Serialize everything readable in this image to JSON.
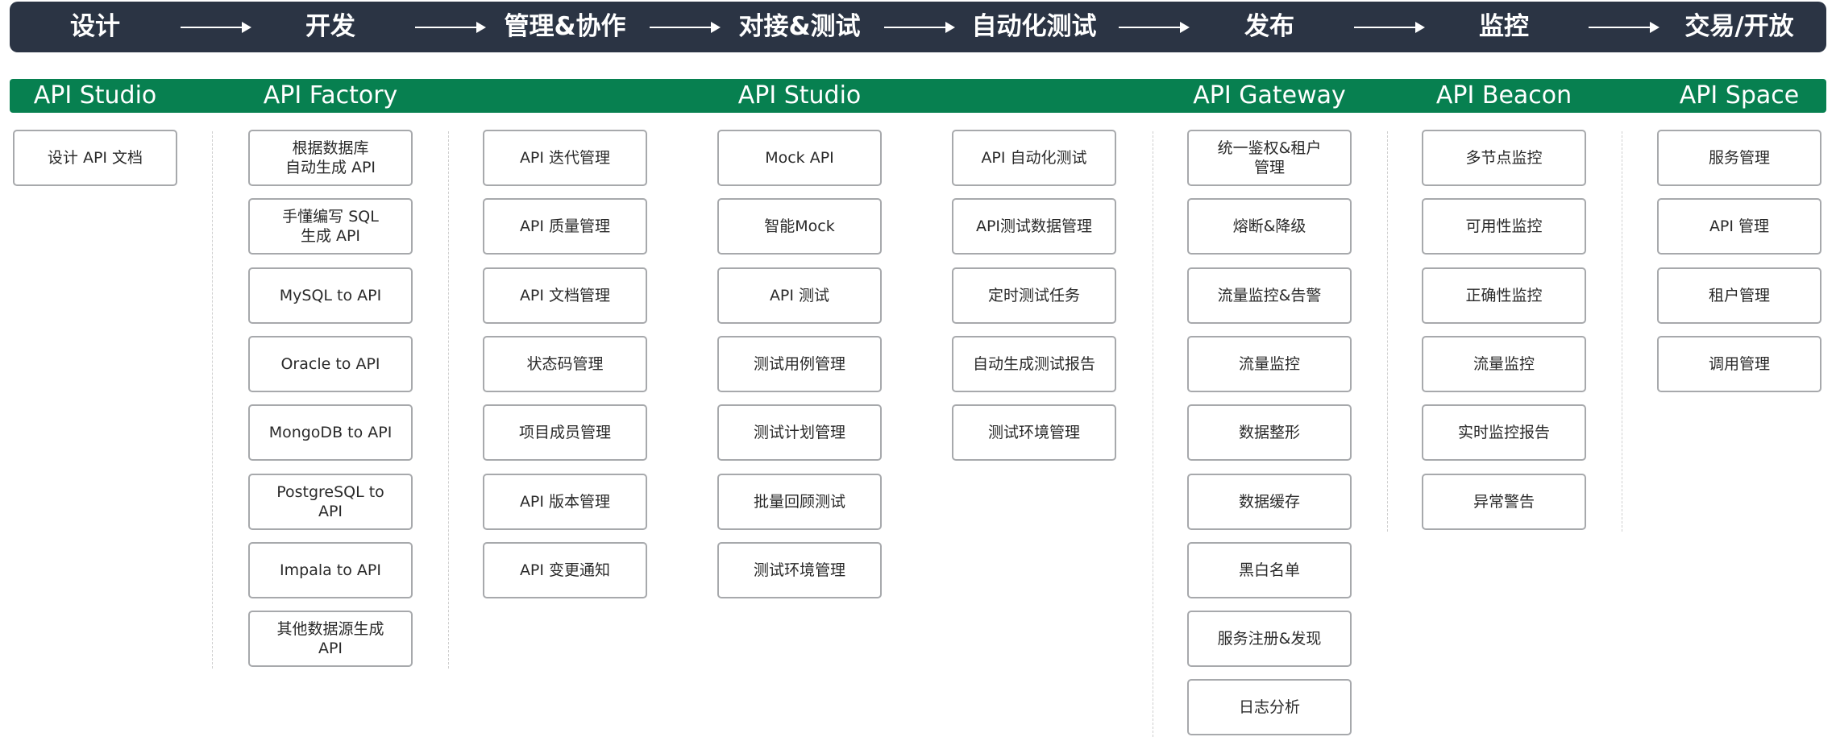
{
  "stages": [
    "设计",
    "开发",
    "管理&协作",
    "对接&测试",
    "自动化测试",
    "发布",
    "监控",
    "交易/开放"
  ],
  "products": [
    "API Studio",
    "API Factory",
    "API Studio",
    "API Gateway",
    "API Beacon",
    "API Space"
  ],
  "columns": [
    {
      "items": [
        "设计 API 文档"
      ]
    },
    {
      "items": [
        "根据数据库\n自动生成 API",
        "手懂编写 SQL\n生成 API",
        "MySQL to API",
        "Oracle to API",
        "MongoDB to API",
        "PostgreSQL to\nAPI",
        "Impala to API",
        "其他数据源生成\nAPI"
      ]
    },
    {
      "items": [
        "API 迭代管理",
        "API 质量管理",
        "API 文档管理",
        "状态码管理",
        "项目成员管理",
        "API 版本管理",
        "API 变更通知"
      ]
    },
    {
      "items": [
        "Mock API",
        "智能Mock",
        "API 测试",
        "测试用例管理",
        "测试计划管理",
        "批量回顾测试",
        "测试环境管理"
      ]
    },
    {
      "items": [
        "API 自动化测试",
        "API测试数据管理",
        "定时测试任务",
        "自动生成测试报告",
        "测试环境管理"
      ]
    },
    {
      "items": [
        "统一鉴权&租户\n管理",
        "熔断&降级",
        "流量监控&告警",
        "流量监控",
        "数据整形",
        "数据缓存",
        "黑白名单",
        "服务注册&发现",
        "日志分析"
      ]
    },
    {
      "items": [
        "多节点监控",
        "可用性监控",
        "正确性监控",
        "流量监控",
        "实时监控报告",
        "异常警告"
      ]
    },
    {
      "items": [
        "服务管理",
        "API 管理",
        "租户管理",
        "调用管理"
      ]
    }
  ],
  "colors": {
    "stage_bar": "#2b3444",
    "product_bar": "#078050",
    "box_border": "#a7a9ac",
    "separator": "#cfcfcf"
  }
}
